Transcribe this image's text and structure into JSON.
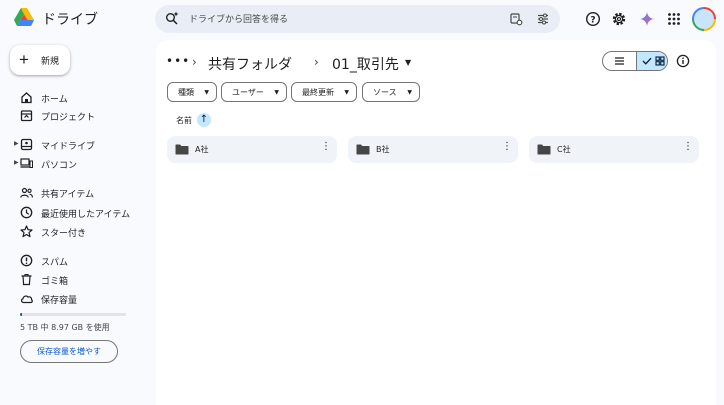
{
  "app": {
    "title": "ドライブ"
  },
  "search": {
    "placeholder": "ドライブから回答を得る"
  },
  "sidebar": {
    "new_label": "新規",
    "items": [
      {
        "label": "ホーム",
        "icon": "home-icon"
      },
      {
        "label": "プロジェクト",
        "icon": "project-icon"
      },
      {
        "label": "マイドライブ",
        "icon": "my-drive-icon"
      },
      {
        "label": "パソコン",
        "icon": "computer-icon"
      },
      {
        "label": "共有アイテム",
        "icon": "shared-people-icon"
      },
      {
        "label": "最近使用したアイテム",
        "icon": "clock-icon"
      },
      {
        "label": "スター付き",
        "icon": "star-icon"
      },
      {
        "label": "スパム",
        "icon": "spam-icon"
      },
      {
        "label": "ゴミ箱",
        "icon": "trash-icon"
      },
      {
        "label": "保存容量",
        "icon": "cloud-icon"
      }
    ],
    "storage": {
      "used_fraction": 0.0018,
      "text": "5 TB 中 8.97 GB を使用",
      "button_label": "保存容量を増やす"
    }
  },
  "breadcrumb": {
    "more": "•••",
    "separator": "›",
    "items": [
      "共有フォルダ",
      "01_取引先"
    ]
  },
  "filters": [
    "種類",
    "ユーザー",
    "最終更新",
    "ソース"
  ],
  "sort": {
    "label": "名前",
    "direction": "↑"
  },
  "folders": [
    {
      "name": "A社"
    },
    {
      "name": "B社"
    },
    {
      "name": "C社"
    }
  ],
  "colors": {
    "accent": "#0b57d0",
    "selected": "#c2e7ff",
    "card": "#f0f4f9",
    "background": "#f8fafd"
  }
}
